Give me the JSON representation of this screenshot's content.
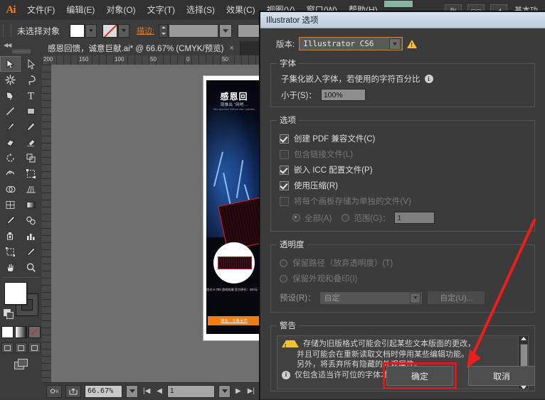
{
  "app": {
    "logo": "Ai",
    "menus": [
      "文件(F)",
      "编辑(E)",
      "对象(O)",
      "文字(T)",
      "选择(S)",
      "效果(C)",
      "视图(V)",
      "窗口(W)",
      "帮助(H)"
    ],
    "workspace_label": "基本功"
  },
  "control_bar": {
    "selection_label": "未选择对象",
    "stroke_label": "描边:",
    "fill_swatch": "#ffffff",
    "stroke_swatch": "none"
  },
  "toolbox": {
    "tools": [
      "selection-tool",
      "direct-selection-tool",
      "magic-wand-tool",
      "lasso-tool",
      "pen-tool",
      "type-tool",
      "line-segment-tool",
      "rectangle-tool",
      "paintbrush-tool",
      "pencil-tool",
      "blob-brush-tool",
      "eraser-tool",
      "rotate-tool",
      "scale-tool",
      "width-tool",
      "free-transform-tool",
      "shape-builder-tool",
      "perspective-grid-tool",
      "mesh-tool",
      "gradient-tool",
      "eyedropper-tool",
      "blend-tool",
      "symbol-sprayer-tool",
      "column-graph-tool",
      "artboard-tool",
      "slice-tool",
      "hand-tool",
      "zoom-tool"
    ],
    "fill_color": "#ffffff",
    "stroke_color": "#4a4a4a"
  },
  "document": {
    "tab_title": "感恩回馈，诚意巨献.ai* @ 66.67% (CMYK/预览)",
    "close_label": "×",
    "ruler_labels": [
      "200",
      "150",
      "100",
      "50",
      "0",
      "50"
    ]
  },
  "artwork": {
    "title": "感恩回",
    "subtitle": "现推出 “网吧...",
    "english": "New launched \"Internet\nafter\" activities",
    "product_text": "炫光 K-780 游戏机械\n官方原价：240元\n一年保修",
    "address_band": "地址：乌鲁木齐"
  },
  "status_bar": {
    "zoom_value": "66.67%",
    "page_value": "1",
    "first_label": "|◀",
    "prev_label": "◀",
    "next_label": "▶",
    "last_label": "▶|"
  },
  "dialog": {
    "title": "Illustrator 选项",
    "version_label": "版本:",
    "version_value": "Illustrator CS6",
    "warning_icon": "warning-triangle",
    "fonts": {
      "legend": "字体",
      "subset_text": "子集化嵌入字体，若使用的字符百分比",
      "info_icon": "i",
      "less_than_label": "小于(S)：",
      "less_than_value": "100%"
    },
    "options": {
      "legend": "选项",
      "items": [
        {
          "label": "创建 PDF 兼容文件(C)",
          "checked": true,
          "disabled": false
        },
        {
          "label": "包含链接文件(L)",
          "checked": false,
          "disabled": true
        },
        {
          "label": "嵌入 ICC 配置文件(P)",
          "checked": true,
          "disabled": false
        },
        {
          "label": "使用压缩(R)",
          "checked": true,
          "disabled": false
        },
        {
          "label": "将每个画板存储为单独的文件(V)",
          "checked": false,
          "disabled": true
        }
      ],
      "radio_all": "全部(A)",
      "radio_range": "范围(G)：",
      "range_value": "1"
    },
    "transparency": {
      "legend": "透明度",
      "radio_preserve_paths": "保留路径（放弃透明度）(T)",
      "radio_preserve_appearance": "保留外观和叠印(I)",
      "preset_label": "预设(R)：",
      "preset_value": "自定",
      "custom_button": "自定(U)..."
    },
    "warnings": {
      "legend": "警告",
      "lines": [
        "存储为旧版格式可能会引起某些文本版面的更改，",
        "并且可能会在重新读取文档时停用某些编辑功能。",
        "另外，将丢弃所有隐藏的外观属性。",
        "仅包含适当许可位的字体才能被嵌入。"
      ]
    },
    "buttons": {
      "ok": "确定",
      "cancel": "取消"
    }
  },
  "annotation": {
    "arrow_color": "#ee1c1c",
    "highlight_color": "#e01818"
  }
}
